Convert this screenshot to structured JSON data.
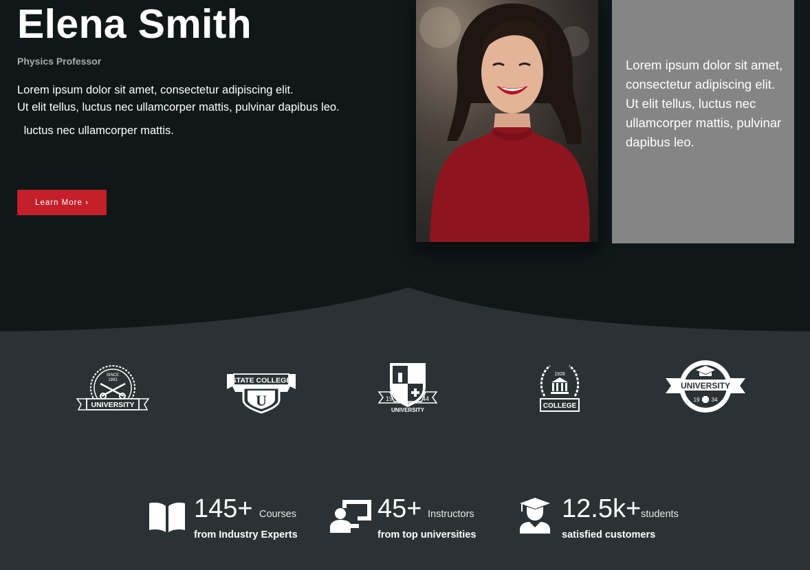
{
  "profile": {
    "name": "Elena Smith",
    "role": "Physics Professor",
    "description_line1": "Lorem ipsum dolor sit amet, consectetur adipiscing elit.",
    "description_line2": "Ut elit tellus, luctus nec ullamcorper mattis, pulvinar dapibus leo.",
    "description_line3": " luctus nec ullamcorper mattis.",
    "button_label": "Learn More ›"
  },
  "side_box": {
    "text": "Lorem ipsum dolor sit amet, consectetur adipiscing elit. Ut elit tellus, luctus nec ullamcorper mattis, pulvinar dapibus leo."
  },
  "logos": [
    {
      "name": "university-keys-logo",
      "top_text": "SINCE",
      "year": "1892",
      "banner": "UNIVERSITY"
    },
    {
      "name": "state-college-logo",
      "banner": "STATE COLLEGE",
      "letter": "U"
    },
    {
      "name": "university-shield-logo",
      "left_num": "19",
      "right_num": "44",
      "banner": "UNIVERSITY"
    },
    {
      "name": "college-wreath-logo",
      "year": "1928",
      "banner": "COLLEGE"
    },
    {
      "name": "university-badge-logo",
      "banner": "UNIVERSITY",
      "left_num": "19",
      "right_num": "34"
    }
  ],
  "stats": [
    {
      "icon": "open-book-icon",
      "number": "145+",
      "unit": "Courses",
      "subtitle": "from Industry Experts"
    },
    {
      "icon": "instructor-screen-icon",
      "number": "45+",
      "unit": "Instructors",
      "subtitle": "from top universities"
    },
    {
      "icon": "graduate-student-icon",
      "number": "12.5k+",
      "unit": "students",
      "subtitle": "satisfied customers"
    }
  ],
  "colors": {
    "hero_background": "#0f1719",
    "section_background": "#2a3235",
    "accent": "#c41f2b",
    "side_box": "#858585"
  }
}
